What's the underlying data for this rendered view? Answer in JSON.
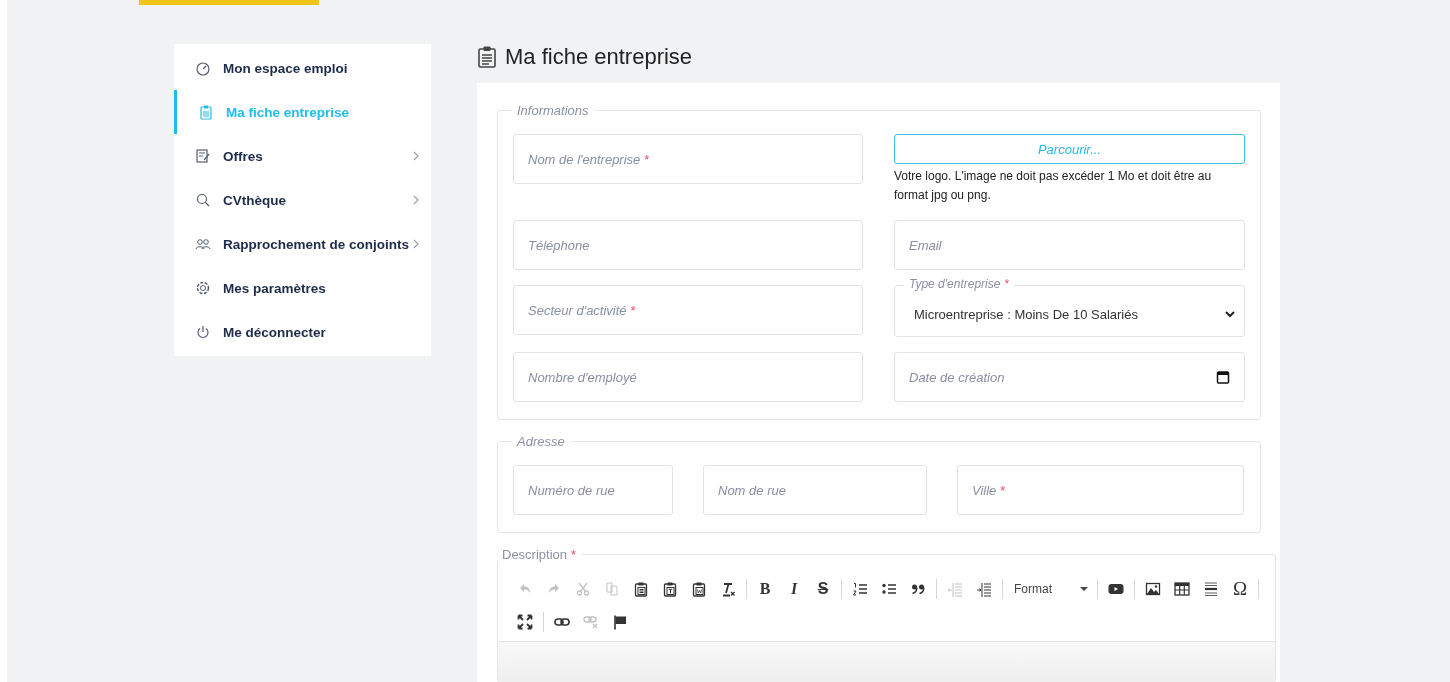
{
  "sidebar": {
    "items": [
      {
        "label": "Mon espace emploi",
        "selected": false,
        "has_submenu": false
      },
      {
        "label": "Ma fiche entreprise",
        "selected": true,
        "has_submenu": false
      },
      {
        "label": "Offres",
        "selected": false,
        "has_submenu": true
      },
      {
        "label": "CVthèque",
        "selected": false,
        "has_submenu": true
      },
      {
        "label": "Rapprochement de conjoints",
        "selected": false,
        "has_submenu": true
      },
      {
        "label": "Mes paramètres",
        "selected": false,
        "has_submenu": false
      },
      {
        "label": "Me déconnecter",
        "selected": false,
        "has_submenu": false
      }
    ]
  },
  "page_title": "Ma fiche entreprise",
  "informations": {
    "legend": "Informations",
    "fields": [
      {
        "kind": "text",
        "placeholder": "Nom de l'entreprise",
        "required_mark": "*"
      },
      {
        "kind": "file",
        "button": "Parcourir...",
        "help": "Votre logo. L'image ne doit pas excéder 1 Mo et doit être au format jpg ou png."
      },
      {
        "kind": "text",
        "placeholder": "Téléphone"
      },
      {
        "kind": "text",
        "placeholder": "Email"
      },
      {
        "kind": "text",
        "placeholder": "Secteur d'activité",
        "required_mark": "*"
      },
      {
        "kind": "select",
        "label": "Type d'entreprise",
        "required_mark": "*",
        "value": "Microentreprise : Moins De 10 Salariés"
      },
      {
        "kind": "text",
        "placeholder": "Nombre d'employé"
      },
      {
        "kind": "date",
        "placeholder": "Date de création"
      }
    ]
  },
  "adresse": {
    "legend": "Adresse",
    "fields": [
      {
        "kind": "text",
        "placeholder": "Numéro de rue"
      },
      {
        "kind": "text",
        "placeholder": "Nom de rue"
      },
      {
        "kind": "text",
        "placeholder": "Ville",
        "required_mark": "*"
      }
    ]
  },
  "description": {
    "legend": "Description",
    "required_mark": "*",
    "toolbar_rows": [
      [
        {
          "kind": "undo",
          "disabled": true
        },
        {
          "kind": "redo",
          "disabled": true
        },
        {
          "kind": "cut",
          "disabled": true
        },
        {
          "kind": "copy",
          "disabled": true
        },
        {
          "kind": "paste",
          "disabled": false
        },
        {
          "kind": "paste-text",
          "disabled": false
        },
        {
          "kind": "paste-word",
          "disabled": false
        },
        {
          "kind": "clear-format",
          "disabled": false
        },
        {
          "kind": "separator"
        },
        {
          "kind": "bold",
          "label": "B",
          "disabled": false
        },
        {
          "kind": "italic",
          "label": "I",
          "disabled": false
        },
        {
          "kind": "strike",
          "label": "S",
          "disabled": false
        },
        {
          "kind": "separator"
        },
        {
          "kind": "numbered-list",
          "disabled": false
        },
        {
          "kind": "bulleted-list",
          "disabled": false
        },
        {
          "kind": "quote",
          "disabled": false
        },
        {
          "kind": "separator"
        },
        {
          "kind": "outdent",
          "disabled": true
        },
        {
          "kind": "indent",
          "disabled": false
        },
        {
          "kind": "separator"
        },
        {
          "kind": "format",
          "label": "Format"
        },
        {
          "kind": "separator"
        },
        {
          "kind": "video",
          "disabled": false
        },
        {
          "kind": "separator"
        },
        {
          "kind": "image",
          "disabled": false
        },
        {
          "kind": "table",
          "disabled": false
        },
        {
          "kind": "horizontal-line",
          "disabled": false
        },
        {
          "kind": "symbol",
          "label": "Ω",
          "disabled": false
        },
        {
          "kind": "separator"
        }
      ],
      [
        {
          "kind": "maximize",
          "disabled": false
        },
        {
          "kind": "separator"
        },
        {
          "kind": "link",
          "disabled": false
        },
        {
          "kind": "unlink",
          "disabled": true
        },
        {
          "kind": "anchor",
          "disabled": false
        }
      ]
    ]
  }
}
